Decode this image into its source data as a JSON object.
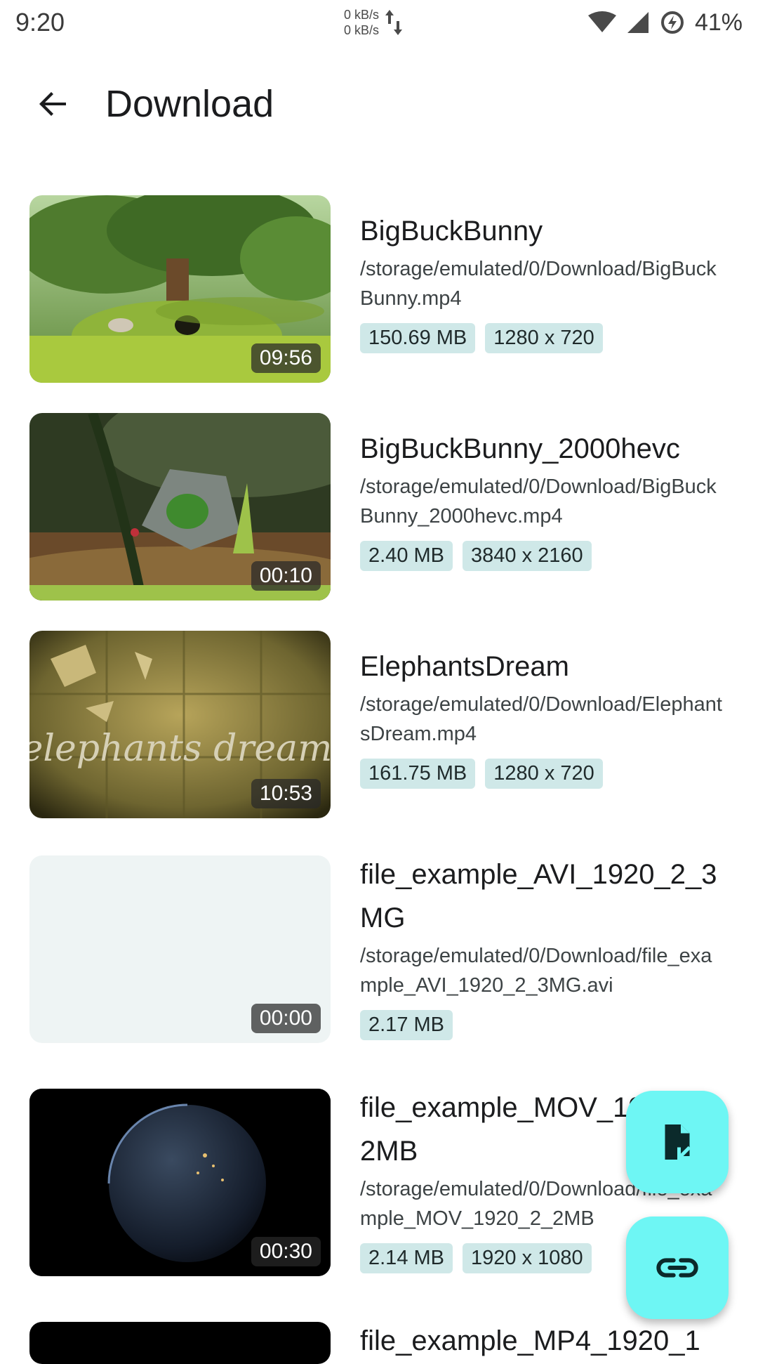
{
  "status_bar": {
    "time": "9:20",
    "net_up": "0 kB/s",
    "net_down": "0 kB/s",
    "battery": "41%"
  },
  "app_bar": {
    "title": "Download"
  },
  "colors": {
    "accent_chip": "#cfe8e8",
    "fab": "#6ef6f4"
  },
  "videos": [
    {
      "title": "BigBuckBunny",
      "path": "/storage/emulated/0/Download/BigBuckBunny.mp4",
      "size": "150.69 MB",
      "resolution": "1280 x 720",
      "duration": "09:56"
    },
    {
      "title": "BigBuckBunny_2000hevc",
      "path": "/storage/emulated/0/Download/BigBuckBunny_2000hevc.mp4",
      "size": "2.40 MB",
      "resolution": "3840 x 2160",
      "duration": "00:10"
    },
    {
      "title": "ElephantsDream",
      "path": "/storage/emulated/0/Download/ElephantsDream.mp4",
      "size": "161.75 MB",
      "resolution": "1280 x 720",
      "duration": "10:53",
      "thumb_text": "elephants dream"
    },
    {
      "title": "file_example_AVI_1920_2_3MG",
      "path": "/storage/emulated/0/Download/file_example_AVI_1920_2_3MG.avi",
      "size": "2.17 MB",
      "duration": "00:00"
    },
    {
      "title": "file_example_MOV_1920_2_2MB",
      "path": "/storage/emulated/0/Download/file_example_MOV_1920_2_2MB",
      "size": "2.14 MB",
      "resolution": "1920 x 1080",
      "duration": "00:30"
    },
    {
      "title": "file_example_MP4_1920_1"
    }
  ],
  "fabs": {
    "open_file_icon": "file-open-icon",
    "open_link_icon": "link-icon"
  }
}
